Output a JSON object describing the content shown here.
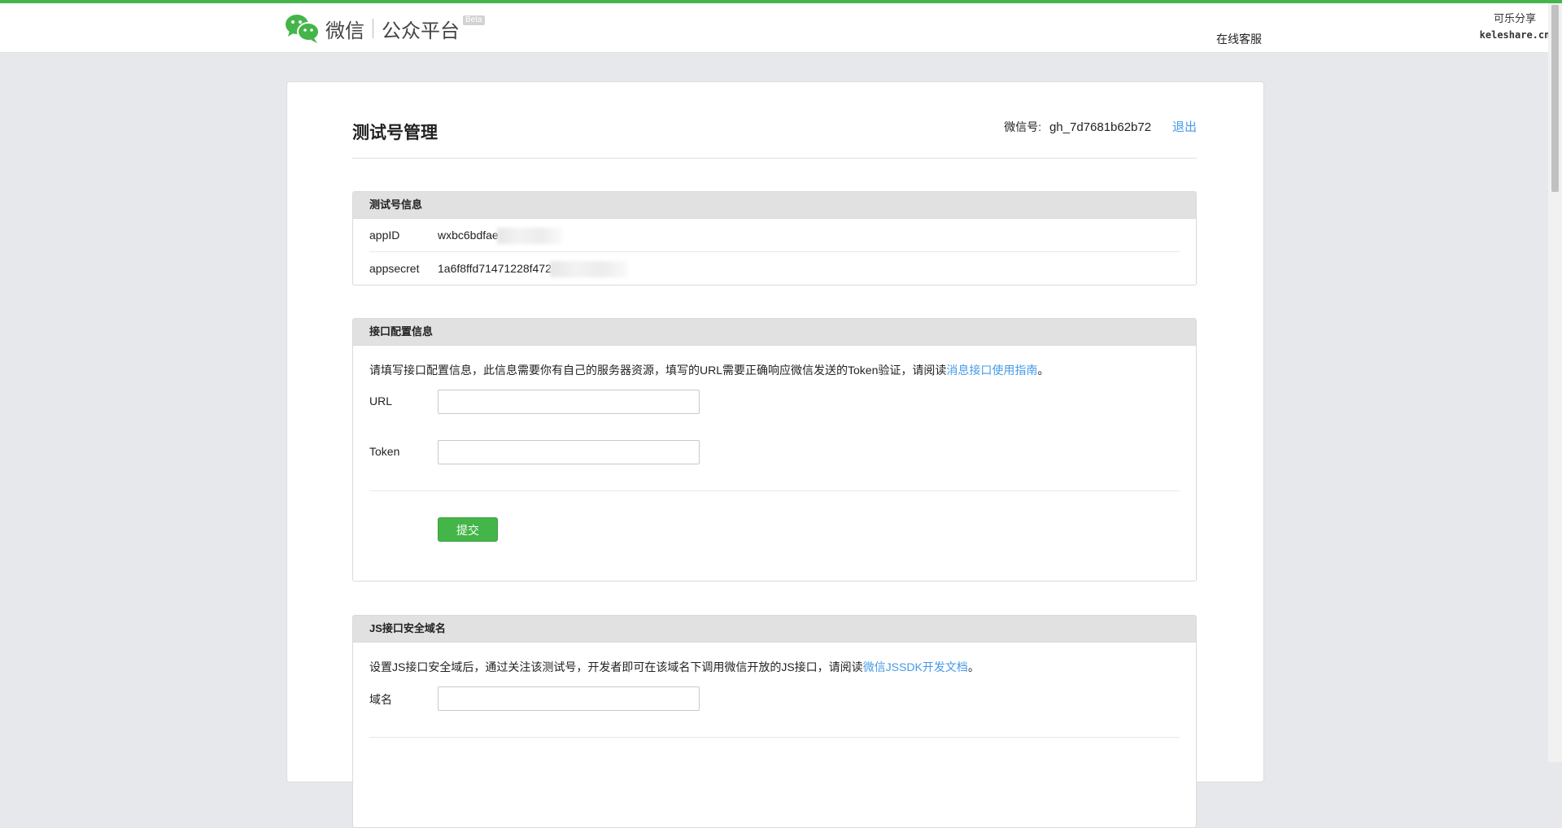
{
  "header": {
    "logo_main": "微信",
    "logo_sub": "公众平台",
    "logo_badge": "Beta",
    "service_link": "在线客服",
    "watermark_line1": "可乐分享",
    "watermark_line2": "keleshare.cn"
  },
  "page": {
    "title": "测试号管理",
    "account_label": "微信号:",
    "account_id": "gh_7d7681b62b72",
    "logout": "退出"
  },
  "test_info": {
    "title": "测试号信息",
    "rows": [
      {
        "key": "appID",
        "value": "wxbc6bdfae"
      },
      {
        "key": "appsecret",
        "value": "1a6f8ffd71471228f472"
      }
    ]
  },
  "interface_config": {
    "title": "接口配置信息",
    "desc_prefix": "请填写接口配置信息，此信息需要你有自己的服务器资源，填写的URL需要正确响应微信发送的Token验证，请阅读",
    "desc_link": "消息接口使用指南",
    "desc_suffix": "。",
    "url_label": "URL",
    "url_value": "",
    "token_label": "Token",
    "token_value": "",
    "submit_label": "提交"
  },
  "js_domain": {
    "title": "JS接口安全域名",
    "desc_prefix": "设置JS接口安全域后，通过关注该测试号，开发者即可在该域名下调用微信开放的JS接口，请阅读",
    "desc_link": "微信JSSDK开发文档",
    "desc_suffix": "。",
    "domain_label": "域名",
    "domain_value": ""
  },
  "colors": {
    "brand_green": "#44b549",
    "link_blue": "#459ae9"
  }
}
